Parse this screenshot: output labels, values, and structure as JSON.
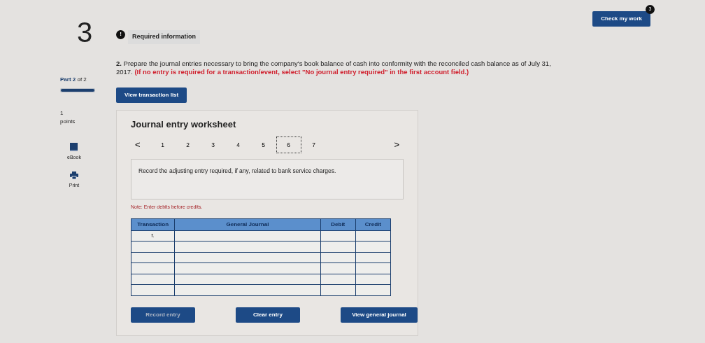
{
  "check_button": {
    "label": "Check my work",
    "badge": "3"
  },
  "question": {
    "number": "3",
    "part": {
      "text": "**Part 2** of 2",
      "level": 1
    },
    "points_value": "1",
    "points_label": "points"
  },
  "tools": [
    {
      "kind": "ebook",
      "label": "eBook"
    },
    {
      "kind": "print",
      "label": "Print"
    }
  ],
  "required_info": {
    "badge": "!",
    "label": "Required information"
  },
  "instruction": {
    "text": "**2.** Prepare the journal entries necessary to bring the company's book balance of cash into conformity with the reconciled cash balance as of July 31, 2017.",
    "note": "(If no entry is required for a transaction/event, select \"No journal entry required\" in the first account field.)"
  },
  "view_transactions_button": "View transaction list",
  "worksheet": {
    "title": "Journal entry worksheet",
    "prev": "<",
    "next": ">",
    "pages": [
      {
        "label": "1",
        "selected": false
      },
      {
        "label": "2",
        "selected": false
      },
      {
        "label": "3",
        "selected": false
      },
      {
        "label": "4",
        "selected": false
      },
      {
        "label": "5",
        "selected": false
      },
      {
        "label": "6",
        "selected": true
      },
      {
        "label": "7",
        "selected": false
      }
    ],
    "prompt": "Record the adjusting entry required, if any, related to bank service charges.",
    "note": "Note: Enter debits before credits.",
    "columns": [
      "Transaction",
      "General Journal",
      "Debit",
      "Credit"
    ],
    "rows": [
      {
        "transaction": "f."
      },
      {},
      {},
      {},
      {},
      {}
    ],
    "buttons": [
      {
        "label": "Record entry",
        "disabled": true
      },
      {
        "label": "Clear entry",
        "disabled": false
      },
      {
        "label": "View general journal",
        "disabled": false
      }
    ]
  }
}
